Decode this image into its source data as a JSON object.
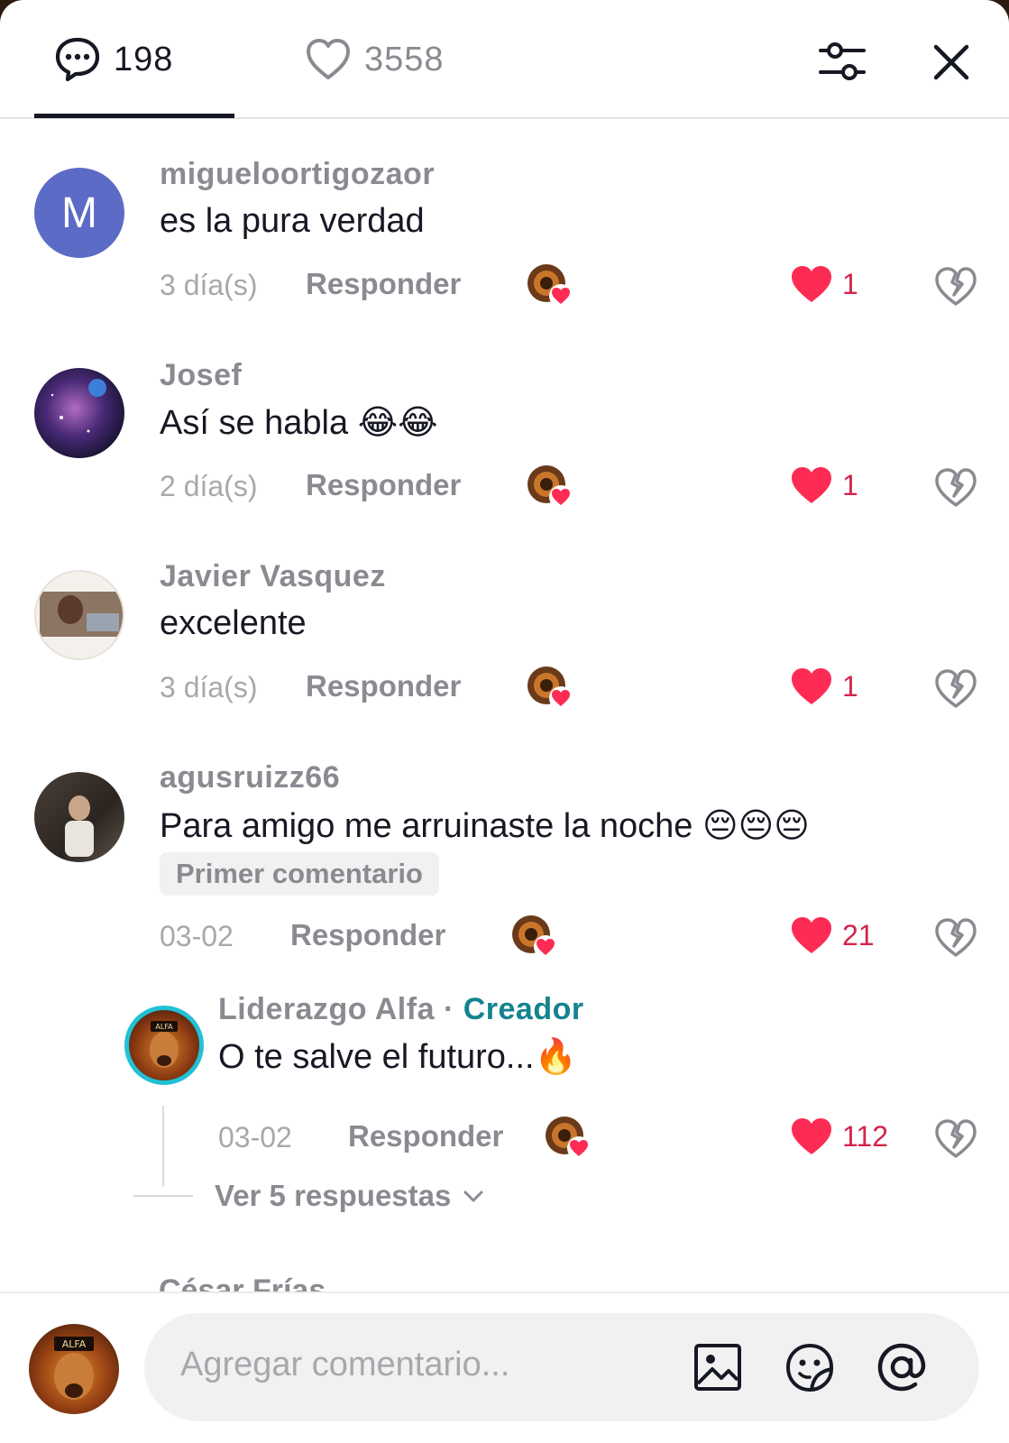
{
  "header": {
    "comments_count": "198",
    "likes_count": "3558"
  },
  "colors": {
    "like_red": "#fe2c55",
    "creator_teal": "#138490",
    "avatar_m_bg": "#5b6bc6"
  },
  "icons": {
    "comments_tab": "chat-bubble-icon",
    "likes_tab": "heart-outline-icon",
    "filter": "sliders-icon",
    "close": "close-icon",
    "like": "heart-filled-icon",
    "dislike": "broken-heart-icon",
    "image": "image-icon",
    "sticker": "emoji-sticker-icon",
    "mention": "at-icon",
    "expand": "chevron-down-icon"
  },
  "comments": [
    {
      "username": "migueloortigozaor",
      "avatar_letter": "M",
      "text": "es la pura verdad",
      "time": "3 día(s)",
      "reply_label": "Responder",
      "likes": "1"
    },
    {
      "username": "Josef",
      "text": "Así se habla 😂😂",
      "time": "2 día(s)",
      "reply_label": "Responder",
      "likes": "1"
    },
    {
      "username": "Javier Vasquez",
      "text": "excelente",
      "time": "3 día(s)",
      "reply_label": "Responder",
      "likes": "1"
    },
    {
      "username": "agusruizz66",
      "text": "Para amigo me arruinaste la noche 😔😔😔",
      "badge": "Primer comentario",
      "time": "03-02",
      "reply_label": "Responder",
      "likes": "21"
    }
  ],
  "reply": {
    "username": "Liderazgo Alfa",
    "separator": " · ",
    "creator_label": "Creador",
    "text": "O te salve el futuro...🔥",
    "time": "03-02",
    "reply_label": "Responder",
    "likes": "112",
    "avatar_text": "ALFA"
  },
  "view_replies": "Ver 5 respuestas",
  "next_comment_peek": "César Frías",
  "composer": {
    "placeholder": "Agregar comentario...",
    "avatar_text": "ALFA"
  }
}
